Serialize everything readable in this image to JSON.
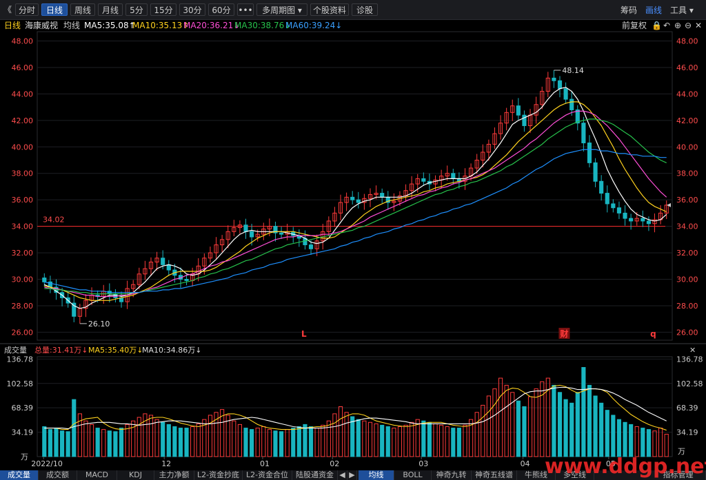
{
  "toolbar": {
    "back_label": "《",
    "buttons": [
      "分时",
      "日线",
      "周线",
      "月线",
      "5分",
      "15分",
      "30分",
      "60分",
      "•••",
      "多周期图 ▾",
      "个股资料",
      "诊股"
    ],
    "active_index": 1,
    "right_links": [
      "筹码",
      "画线",
      "工具 ▾"
    ]
  },
  "ma_bar": {
    "period": "日线",
    "name": "海康威视",
    "mode": "均线",
    "ma5": "MA5:35.08↑",
    "ma10": "MA10:35.13↑",
    "ma20": "MA20:36.21↓",
    "ma30": "MA30:38.76↓",
    "ma60": "MA60:39.24↓",
    "adjust": "前复权"
  },
  "colors": {
    "up": "#ff3b3b",
    "down": "#19b5c0",
    "ma5": "#ffffff",
    "ma10": "#ffd21e",
    "ma20": "#ff4fd8",
    "ma30": "#27c24c",
    "ma60": "#1e90ff",
    "vol_ma5": "#ffd21e",
    "vol_ma10": "#ffffff",
    "ref_line": "#ff2a2a",
    "axis_text": "#ff4d4d"
  },
  "volume_bar": {
    "title": "成交量",
    "total": "总量:31.41万↓",
    "ma5": "MA5:35.40万↓",
    "ma10": "MA10:34.86万↓"
  },
  "chart_data": {
    "type": "candlestick",
    "y_ticks": [
      "48.00",
      "46.00",
      "44.00",
      "42.00",
      "40.00",
      "38.00",
      "36.00",
      "34.00",
      "32.00",
      "30.00",
      "28.00",
      "26.00"
    ],
    "ylim": [
      25.5,
      48.6
    ],
    "ref_line": {
      "value": 34.0,
      "label": "34.02"
    },
    "high_label": "48.14",
    "low_label": "26.10",
    "x_labels": [
      "2022/10",
      "12",
      "01",
      "02",
      "03",
      "04",
      "05"
    ],
    "markers": [
      "L",
      "财",
      "q"
    ],
    "close": [
      29.8,
      29.4,
      29.0,
      28.6,
      28.2,
      27.2,
      27.8,
      28.4,
      28.8,
      28.7,
      29.1,
      28.9,
      28.6,
      28.3,
      29.3,
      29.6,
      30.4,
      30.8,
      31.3,
      31.6,
      31.1,
      30.7,
      30.3,
      30.0,
      29.9,
      30.4,
      31.0,
      31.6,
      32.0,
      32.6,
      33.0,
      33.6,
      33.9,
      34.1,
      33.6,
      33.2,
      33.4,
      33.8,
      34.0,
      33.5,
      33.4,
      33.6,
      33.3,
      33.1,
      32.6,
      32.3,
      32.9,
      33.6,
      34.4,
      35.0,
      35.8,
      36.2,
      36.0,
      35.8,
      36.1,
      36.4,
      36.5,
      36.2,
      35.8,
      35.9,
      36.3,
      36.7,
      37.2,
      37.6,
      37.4,
      37.2,
      37.5,
      37.8,
      38.0,
      37.6,
      37.4,
      37.8,
      38.4,
      39.0,
      39.6,
      40.2,
      41.0,
      41.8,
      42.6,
      43.1,
      42.4,
      41.6,
      42.4,
      43.2,
      44.2,
      45.2,
      45.0,
      44.4,
      43.6,
      42.8,
      41.8,
      40.3,
      38.8,
      37.4,
      36.5,
      35.7,
      35.4,
      35.0,
      34.6,
      34.4,
      34.6,
      34.4,
      34.2,
      34.5,
      35.0,
      35.6
    ],
    "ma_series": {
      "MA5": [
        29.6,
        29.4,
        29.1,
        28.8,
        28.4,
        28.0,
        27.8,
        27.9,
        28.2,
        28.4,
        28.6,
        28.8,
        28.8,
        28.7,
        28.8,
        29.0,
        29.4,
        29.8,
        30.3,
        30.8,
        31.0,
        31.1,
        31.0,
        30.8,
        30.4,
        30.3,
        30.4,
        30.7,
        31.1,
        31.5,
        32.0,
        32.5,
        33.0,
        33.4,
        33.6,
        33.7,
        33.6,
        33.6,
        33.6,
        33.6,
        33.6,
        33.5,
        33.4,
        33.3,
        33.1,
        32.8,
        32.7,
        32.8,
        33.1,
        33.7,
        34.3,
        34.9,
        35.4,
        35.7,
        35.9,
        36.0,
        36.2,
        36.2,
        36.2,
        36.2,
        36.2,
        36.3,
        36.5,
        36.8,
        37.1,
        37.3,
        37.4,
        37.5,
        37.6,
        37.6,
        37.6,
        37.6,
        37.8,
        38.1,
        38.6,
        39.1,
        39.7,
        40.3,
        41.0,
        41.7,
        42.0,
        42.2,
        42.4,
        42.6,
        43.0,
        43.6,
        44.1,
        44.4,
        44.5,
        44.2,
        43.6,
        42.7,
        41.6,
        40.6,
        39.5,
        38.3,
        37.4,
        36.6,
        35.9,
        35.3,
        34.9,
        34.7,
        34.5,
        34.4,
        34.5,
        34.9
      ],
      "MA10": [
        29.5,
        29.4,
        29.3,
        29.2,
        29.0,
        28.8,
        28.6,
        28.5,
        28.4,
        28.4,
        28.4,
        28.4,
        28.5,
        28.6,
        28.7,
        28.8,
        29.0,
        29.2,
        29.4,
        29.7,
        30.0,
        30.3,
        30.5,
        30.6,
        30.6,
        30.6,
        30.6,
        30.6,
        30.7,
        30.9,
        31.2,
        31.5,
        31.8,
        32.1,
        32.5,
        32.8,
        33.1,
        33.3,
        33.5,
        33.6,
        33.6,
        33.6,
        33.6,
        33.5,
        33.4,
        33.3,
        33.2,
        33.1,
        33.1,
        33.2,
        33.5,
        33.8,
        34.1,
        34.5,
        34.9,
        35.2,
        35.5,
        35.7,
        35.9,
        36.0,
        36.1,
        36.2,
        36.3,
        36.4,
        36.6,
        36.7,
        36.9,
        37.0,
        37.2,
        37.3,
        37.4,
        37.5,
        37.6,
        37.7,
        37.9,
        38.2,
        38.6,
        39.0,
        39.4,
        39.9,
        40.4,
        40.8,
        41.2,
        41.6,
        42.0,
        42.4,
        42.8,
        43.1,
        43.3,
        43.4,
        43.4,
        43.2,
        42.8,
        42.2,
        41.6,
        40.8,
        40.0,
        39.1,
        38.3,
        37.6,
        36.9,
        36.3,
        35.8,
        35.5,
        35.3,
        35.1
      ],
      "MA20": [
        29.4,
        29.3,
        29.3,
        29.2,
        29.1,
        29.0,
        28.9,
        28.8,
        28.8,
        28.7,
        28.7,
        28.7,
        28.7,
        28.8,
        28.8,
        28.9,
        29.0,
        29.1,
        29.3,
        29.4,
        29.6,
        29.8,
        30.0,
        30.1,
        30.3,
        30.4,
        30.6,
        30.8,
        31.0,
        31.1,
        31.3,
        31.4,
        31.6,
        31.8,
        32.0,
        32.2,
        32.4,
        32.6,
        32.8,
        33.0,
        33.1,
        33.2,
        33.2,
        33.3,
        33.3,
        33.3,
        33.3,
        33.4,
        33.4,
        33.5,
        33.6,
        33.8,
        34.0,
        34.2,
        34.4,
        34.7,
        34.9,
        35.1,
        35.3,
        35.5,
        35.7,
        35.9,
        36.1,
        36.3,
        36.4,
        36.6,
        36.7,
        36.9,
        37.0,
        37.2,
        37.3,
        37.5,
        37.6,
        37.8,
        38.0,
        38.2,
        38.4,
        38.7,
        39.0,
        39.3,
        39.6,
        39.9,
        40.3,
        40.6,
        41.0,
        41.4,
        41.8,
        42.1,
        42.4,
        42.6,
        42.7,
        42.7,
        42.6,
        42.4,
        42.0,
        41.6,
        41.1,
        40.6,
        40.0,
        39.4,
        38.8,
        38.2,
        37.6,
        37.1,
        36.6,
        36.2
      ],
      "MA30": [
        29.3,
        29.3,
        29.2,
        29.2,
        29.1,
        29.1,
        29.0,
        29.0,
        28.9,
        28.9,
        28.9,
        28.9,
        28.9,
        28.9,
        28.9,
        29.0,
        29.0,
        29.1,
        29.2,
        29.3,
        29.4,
        29.5,
        29.6,
        29.7,
        29.8,
        29.9,
        30.1,
        30.2,
        30.4,
        30.5,
        30.7,
        30.8,
        31.0,
        31.2,
        31.4,
        31.5,
        31.7,
        31.9,
        32.1,
        32.3,
        32.4,
        32.6,
        32.7,
        32.8,
        32.9,
        33.0,
        33.1,
        33.2,
        33.3,
        33.4,
        33.5,
        33.6,
        33.7,
        33.9,
        34.0,
        34.2,
        34.4,
        34.6,
        34.8,
        35.0,
        35.2,
        35.4,
        35.6,
        35.8,
        36.0,
        36.2,
        36.4,
        36.5,
        36.7,
        36.8,
        37.0,
        37.1,
        37.3,
        37.4,
        37.6,
        37.8,
        38.0,
        38.2,
        38.5,
        38.7,
        39.0,
        39.3,
        39.6,
        39.9,
        40.2,
        40.6,
        40.9,
        41.2,
        41.5,
        41.7,
        41.9,
        42.0,
        42.1,
        42.1,
        42.0,
        41.9,
        41.7,
        41.4,
        41.1,
        40.8,
        40.4,
        40.0,
        39.6,
        39.3,
        39.0,
        38.8
      ],
      "MA60": [
        29.8,
        29.7,
        29.6,
        29.5,
        29.4,
        29.3,
        29.2,
        29.2,
        29.1,
        29.1,
        29.1,
        29.0,
        29.0,
        29.0,
        29.0,
        29.0,
        29.0,
        29.1,
        29.1,
        29.1,
        29.2,
        29.2,
        29.3,
        29.3,
        29.4,
        29.5,
        29.6,
        29.7,
        29.8,
        29.9,
        30.0,
        30.1,
        30.3,
        30.4,
        30.5,
        30.7,
        30.8,
        30.9,
        31.1,
        31.2,
        31.3,
        31.5,
        31.6,
        31.7,
        31.8,
        31.9,
        32.0,
        32.1,
        32.2,
        32.3,
        32.5,
        32.6,
        32.8,
        32.9,
        33.1,
        33.2,
        33.4,
        33.5,
        33.6,
        33.8,
        33.9,
        34.1,
        34.2,
        34.4,
        34.5,
        34.7,
        34.8,
        35.0,
        35.1,
        35.3,
        35.4,
        35.6,
        35.7,
        35.9,
        36.1,
        36.3,
        36.5,
        36.7,
        36.9,
        37.2,
        37.4,
        37.7,
        38.0,
        38.3,
        38.5,
        38.8,
        39.1,
        39.3,
        39.5,
        39.6,
        39.7,
        39.8,
        39.8,
        39.8,
        39.7,
        39.7,
        39.6,
        39.5,
        39.5,
        39.4,
        39.4,
        39.3,
        39.3,
        39.3,
        39.2,
        39.2
      ]
    },
    "volume": {
      "y_ticks": [
        "136.78",
        "102.58",
        "68.39",
        "34.19"
      ],
      "unit": "万",
      "ylim": [
        0,
        140
      ],
      "values": [
        42,
        38,
        40,
        36,
        35,
        80,
        60,
        50,
        45,
        40,
        38,
        36,
        35,
        40,
        45,
        50,
        55,
        60,
        58,
        52,
        48,
        45,
        42,
        40,
        40,
        42,
        46,
        52,
        58,
        62,
        66,
        58,
        50,
        45,
        40,
        38,
        40,
        42,
        38,
        36,
        35,
        38,
        40,
        42,
        45,
        42,
        40,
        44,
        50,
        60,
        70,
        62,
        56,
        52,
        50,
        48,
        46,
        44,
        42,
        40,
        42,
        44,
        48,
        52,
        50,
        48,
        46,
        44,
        42,
        40,
        40,
        44,
        52,
        62,
        72,
        85,
        95,
        110,
        100,
        90,
        78,
        70,
        84,
        95,
        105,
        110,
        100,
        90,
        80,
        75,
        90,
        125,
        100,
        85,
        75,
        65,
        58,
        52,
        48,
        45,
        42,
        40,
        38,
        36,
        40,
        31.41
      ],
      "ma5": [
        40,
        40,
        40,
        38,
        38,
        46,
        50,
        53,
        54,
        55,
        47,
        42,
        39,
        38,
        39,
        41,
        45,
        50,
        54,
        55,
        55,
        53,
        50,
        47,
        45,
        43,
        42,
        44,
        47,
        52,
        57,
        60,
        60,
        58,
        55,
        50,
        45,
        42,
        40,
        39,
        38,
        38,
        38,
        39,
        40,
        41,
        42,
        42,
        44,
        47,
        53,
        57,
        60,
        60,
        58,
        54,
        50,
        48,
        46,
        44,
        43,
        42,
        43,
        45,
        47,
        48,
        48,
        48,
        46,
        44,
        43,
        42,
        44,
        48,
        55,
        63,
        73,
        85,
        93,
        96,
        95,
        90,
        84,
        83,
        86,
        93,
        99,
        100,
        98,
        93,
        89,
        92,
        95,
        95,
        94,
        90,
        81,
        73,
        66,
        59,
        54,
        49,
        45,
        42,
        40,
        37
      ],
      "ma10": [
        40,
        40,
        40,
        40,
        39,
        42,
        44,
        46,
        47,
        48,
        48,
        48,
        47,
        46,
        46,
        45,
        44,
        45,
        46,
        48,
        49,
        50,
        50,
        50,
        49,
        48,
        47,
        46,
        46,
        47,
        48,
        50,
        52,
        53,
        54,
        55,
        54,
        52,
        50,
        48,
        46,
        44,
        42,
        41,
        40,
        40,
        40,
        40,
        41,
        42,
        44,
        47,
        49,
        51,
        53,
        54,
        54,
        53,
        52,
        51,
        50,
        49,
        47,
        46,
        46,
        46,
        46,
        46,
        46,
        46,
        46,
        46,
        46,
        47,
        49,
        53,
        58,
        64,
        70,
        76,
        82,
        88,
        91,
        92,
        92,
        94,
        96,
        97,
        97,
        96,
        94,
        94,
        95,
        95,
        94,
        92,
        89,
        85,
        80,
        76,
        72,
        67,
        62,
        58,
        54,
        50
      ]
    }
  },
  "tabs_left": [
    "成交量",
    "成交额",
    "MACD",
    "KDJ",
    "主力净额",
    "L2-资金抄底",
    "L2-资金合位",
    "陆股通资金"
  ],
  "tabs_right": [
    "均线",
    "BOLL",
    "神奇九转",
    "神奇五线谱",
    "牛熊线",
    "多空线",
    "指标管理"
  ],
  "watermark": "www.ddgp.net"
}
